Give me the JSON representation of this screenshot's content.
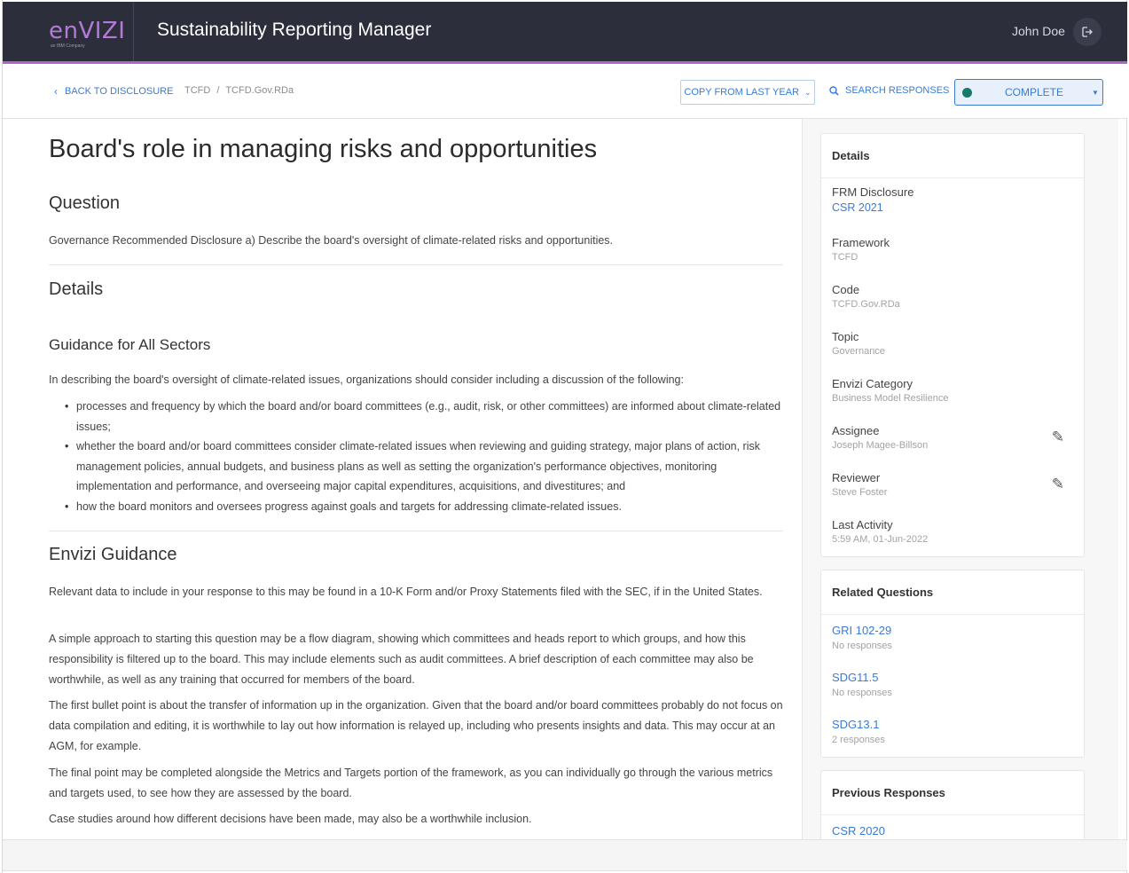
{
  "header": {
    "logo_text": "enVIZI",
    "logo_sub": "an IBM Company",
    "app_title": "Sustainability Reporting Manager",
    "user_name": "John Doe",
    "logout_icon": "logout-icon"
  },
  "toolbar": {
    "back_label": "BACK TO DISCLOSURE",
    "breadcrumb": [
      "TCFD",
      "/",
      "TCFD.Gov.RDa"
    ],
    "copy_label": "COPY FROM LAST YEAR",
    "search_label": "SEARCH RESPONSES",
    "status_value": "COMPLETE",
    "status_color": "#127a6b"
  },
  "main": {
    "title": "Board's role in managing risks and opportunities",
    "question_heading": "Question",
    "question_text": "Governance Recommended Disclosure a) Describe the board's oversight of climate-related risks and opportunities.",
    "details_heading": "Details",
    "guidance_heading": "Guidance for All Sectors",
    "guidance_intro": "In describing the board's oversight of climate-related issues, organizations should consider including a discussion of the following:",
    "guidance_bullets": [
      "processes and frequency by which the board and/or board committees (e.g., audit, risk, or other committees) are informed about climate-related issues;",
      "whether the board and/or board committees consider climate-related issues when reviewing and guiding strategy, major plans of action, risk management policies, annual budgets, and business plans as well as setting the organization's performance objectives, monitoring implementation and performance, and overseeing major capital expenditures, acquisitions, and divestitures; and",
      "how the board monitors and oversees progress against goals and targets for addressing climate-related issues."
    ],
    "envizi_heading": "Envizi Guidance",
    "envizi_paras": [
      "Relevant data to include in your response to this may be found in a 10-K Form and/or Proxy Statements filed with the SEC, if in the United States.",
      "A simple approach to starting this question may be a flow diagram, showing which committees and heads report to which groups, and how this responsibility is filtered up to the board. This may include elements such as audit committees. A brief description of each committee may also be worthwhile, as well as any training that occurred for members of the board.",
      "The first bullet point is about the transfer of information up in the organization. Given that the board and/or board committees probably do not focus on data compilation and editing, it is worthwhile to lay out how information is relayed up, including who presents insights and data. This may occur at an AGM, for example.",
      "The final point may be completed alongside the Metrics and Targets portion of the framework, as you can individually go through the various metrics and targets used, to see how they are assessed by the board.",
      "Case studies around how different decisions have been made, may also be a worthwhile inclusion."
    ]
  },
  "sidebar": {
    "details": {
      "heading": "Details",
      "fields": [
        {
          "label": "FRM Disclosure",
          "value": "CSR 2021"
        },
        {
          "label": "Framework",
          "value": "TCFD"
        },
        {
          "label": "Code",
          "value": "TCFD.Gov.RDa"
        },
        {
          "label": "Topic",
          "value": "Governance"
        },
        {
          "label": "Envizi Category",
          "value": "Business Model Resilience"
        },
        {
          "label": "Assignee",
          "value": "Joseph Magee-Billson"
        },
        {
          "label": "Reviewer",
          "value": "Steve Foster"
        },
        {
          "label": "Last Activity",
          "value": "5:59 AM, 01-Jun-2022"
        }
      ]
    },
    "related": {
      "heading": "Related Questions",
      "items": [
        {
          "code": "GRI 102-29",
          "count": "No responses"
        },
        {
          "code": "SDG11.5",
          "count": "No responses"
        },
        {
          "code": "SDG13.1",
          "count": "2 responses"
        }
      ]
    },
    "previous": {
      "heading": "Previous Responses",
      "items": [
        {
          "code": "CSR 2020"
        }
      ]
    }
  }
}
